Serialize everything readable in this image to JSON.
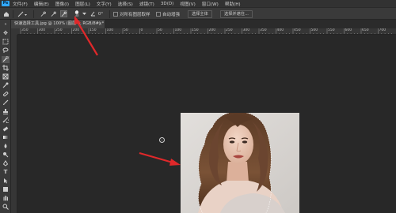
{
  "menubar": {
    "logo": "Ps",
    "items": [
      "文件(F)",
      "编辑(E)",
      "图像(I)",
      "图层(L)",
      "文字(Y)",
      "选择(S)",
      "滤镜(T)",
      "3D(D)",
      "视图(V)",
      "窗口(W)",
      "帮助(H)"
    ]
  },
  "options": {
    "brush_size": "30",
    "angle": "0°",
    "sample_all_layers": "对所有图层取样",
    "auto_enhance": "自动增强",
    "select_subject": "选择主体",
    "select_and_mask": "选择并遮住..."
  },
  "document_tab": {
    "title": "快速选择工具.jpg @ 100% (图层 0, RGB/8#) *",
    "close": "×"
  },
  "ruler": {
    "ticks": [
      "350",
      "300",
      "250",
      "200",
      "150",
      "100",
      "50",
      "0",
      "50",
      "100",
      "150",
      "200",
      "250",
      "300",
      "350",
      "400",
      "450",
      "500",
      "550",
      "600",
      "650",
      "700"
    ]
  },
  "tools": [
    "move-icon",
    "marquee-icon",
    "lasso-icon",
    "quick-select-icon",
    "crop-icon",
    "frame-icon",
    "eyedropper-icon",
    "healing-icon",
    "brush-icon",
    "stamp-icon",
    "history-brush-icon",
    "eraser-icon",
    "gradient-icon",
    "blur-icon",
    "dodge-icon",
    "pen-icon",
    "type-icon",
    "path-select-icon",
    "shape-icon",
    "hand-icon",
    "zoom-icon"
  ],
  "colors": {
    "annotation_arrow": "#e0282a",
    "ps_blue": "#31a8ff"
  }
}
